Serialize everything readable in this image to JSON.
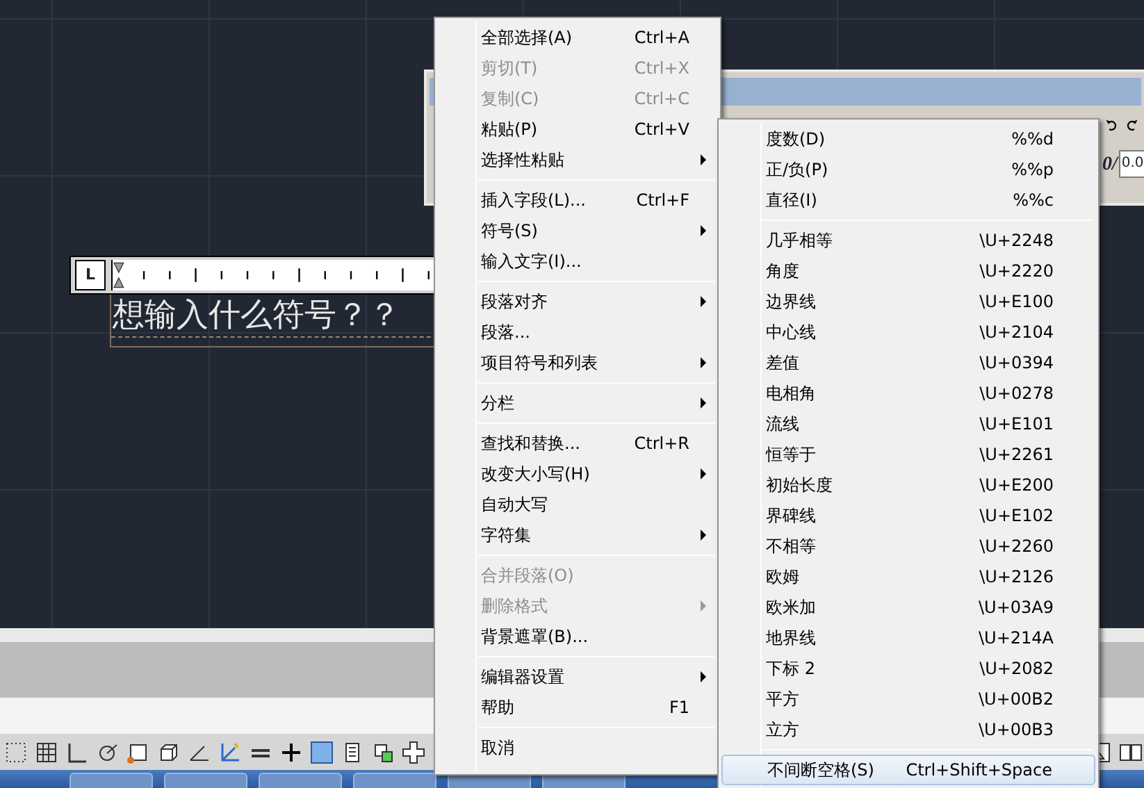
{
  "toolbar": {
    "oblique_label": "0/",
    "oblique_value": "0.0"
  },
  "ruler": {
    "tab_label": "L"
  },
  "editor_text": "想输入什么符号？？",
  "context_menu": [
    {
      "kind": "item",
      "label": "全部选择(A)",
      "shortcut": "Ctrl+A",
      "submenu": false,
      "disabled": false
    },
    {
      "kind": "item",
      "label": "剪切(T)",
      "shortcut": "Ctrl+X",
      "submenu": false,
      "disabled": true
    },
    {
      "kind": "item",
      "label": "复制(C)",
      "shortcut": "Ctrl+C",
      "submenu": false,
      "disabled": true
    },
    {
      "kind": "item",
      "label": "粘贴(P)",
      "shortcut": "Ctrl+V",
      "submenu": false,
      "disabled": false
    },
    {
      "kind": "item",
      "label": "选择性粘贴",
      "submenu": true,
      "disabled": false
    },
    {
      "kind": "separator"
    },
    {
      "kind": "item",
      "label": "插入字段(L)...",
      "shortcut": "Ctrl+F",
      "submenu": false,
      "disabled": false
    },
    {
      "kind": "item",
      "label": "符号(S)",
      "submenu": true,
      "disabled": false
    },
    {
      "kind": "item",
      "label": "输入文字(I)...",
      "submenu": false,
      "disabled": false
    },
    {
      "kind": "separator"
    },
    {
      "kind": "item",
      "label": "段落对齐",
      "submenu": true,
      "disabled": false
    },
    {
      "kind": "item",
      "label": "段落...",
      "submenu": false,
      "disabled": false
    },
    {
      "kind": "item",
      "label": "项目符号和列表",
      "submenu": true,
      "disabled": false
    },
    {
      "kind": "separator"
    },
    {
      "kind": "item",
      "label": "分栏",
      "submenu": true,
      "disabled": false
    },
    {
      "kind": "separator"
    },
    {
      "kind": "item",
      "label": "查找和替换...",
      "shortcut": "Ctrl+R",
      "submenu": false,
      "disabled": false
    },
    {
      "kind": "item",
      "label": "改变大小写(H)",
      "submenu": true,
      "disabled": false
    },
    {
      "kind": "item",
      "label": "自动大写",
      "submenu": false,
      "disabled": false
    },
    {
      "kind": "item",
      "label": "字符集",
      "submenu": true,
      "disabled": false
    },
    {
      "kind": "separator"
    },
    {
      "kind": "item",
      "label": "合并段落(O)",
      "submenu": false,
      "disabled": true
    },
    {
      "kind": "item",
      "label": "删除格式",
      "submenu": true,
      "disabled": true
    },
    {
      "kind": "item",
      "label": "背景遮罩(B)...",
      "submenu": false,
      "disabled": false
    },
    {
      "kind": "separator"
    },
    {
      "kind": "item",
      "label": "编辑器设置",
      "submenu": true,
      "disabled": false
    },
    {
      "kind": "item",
      "label": "帮助",
      "shortcut": "F1",
      "submenu": false,
      "disabled": false
    },
    {
      "kind": "separator"
    },
    {
      "kind": "item",
      "label": "取消",
      "submenu": false,
      "disabled": false
    }
  ],
  "symbol_submenu": [
    {
      "kind": "item",
      "label": "度数(D)",
      "shortcut": "%%d",
      "selected": false
    },
    {
      "kind": "item",
      "label": "正/负(P)",
      "shortcut": "%%p",
      "selected": false
    },
    {
      "kind": "item",
      "label": "直径(I)",
      "shortcut": "%%c",
      "selected": false
    },
    {
      "kind": "separator"
    },
    {
      "kind": "item",
      "label": "几乎相等",
      "shortcut": "\\U+2248",
      "selected": false
    },
    {
      "kind": "item",
      "label": "角度",
      "shortcut": "\\U+2220",
      "selected": false
    },
    {
      "kind": "item",
      "label": "边界线",
      "shortcut": "\\U+E100",
      "selected": false
    },
    {
      "kind": "item",
      "label": "中心线",
      "shortcut": "\\U+2104",
      "selected": false
    },
    {
      "kind": "item",
      "label": "差值",
      "shortcut": "\\U+0394",
      "selected": false
    },
    {
      "kind": "item",
      "label": "电相角",
      "shortcut": "\\U+0278",
      "selected": false
    },
    {
      "kind": "item",
      "label": "流线",
      "shortcut": "\\U+E101",
      "selected": false
    },
    {
      "kind": "item",
      "label": "恒等于",
      "shortcut": "\\U+2261",
      "selected": false
    },
    {
      "kind": "item",
      "label": "初始长度",
      "shortcut": "\\U+E200",
      "selected": false
    },
    {
      "kind": "item",
      "label": "界碑线",
      "shortcut": "\\U+E102",
      "selected": false
    },
    {
      "kind": "item",
      "label": "不相等",
      "shortcut": "\\U+2260",
      "selected": false
    },
    {
      "kind": "item",
      "label": "欧姆",
      "shortcut": "\\U+2126",
      "selected": false
    },
    {
      "kind": "item",
      "label": "欧米加",
      "shortcut": "\\U+03A9",
      "selected": false
    },
    {
      "kind": "item",
      "label": "地界线",
      "shortcut": "\\U+214A",
      "selected": false
    },
    {
      "kind": "item",
      "label": "下标 2",
      "shortcut": "\\U+2082",
      "selected": false
    },
    {
      "kind": "item",
      "label": "平方",
      "shortcut": "\\U+00B2",
      "selected": false
    },
    {
      "kind": "item",
      "label": "立方",
      "shortcut": "\\U+00B3",
      "selected": false
    },
    {
      "kind": "separator"
    },
    {
      "kind": "item",
      "label": "不间断空格(S)",
      "shortcut": "Ctrl+Shift+Space",
      "selected": true
    }
  ]
}
